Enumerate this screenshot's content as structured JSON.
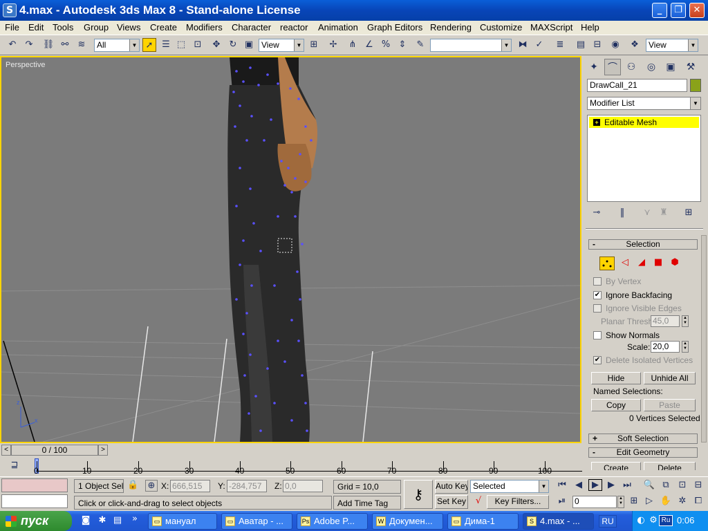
{
  "window": {
    "title": "4.max - Autodesk 3ds Max 8  - Stand-alone License",
    "app_icon": "3ds-max-icon"
  },
  "menu": [
    "File",
    "Edit",
    "Tools",
    "Group",
    "Views",
    "Create",
    "Modifiers",
    "Character",
    "reactor",
    "Animation",
    "Graph Editors",
    "Rendering",
    "Customize",
    "MAXScript",
    "Help"
  ],
  "toolbar": {
    "selection_filter": "All",
    "ref_coord": "View",
    "named_sel": "",
    "view_right": "View"
  },
  "viewport": {
    "label": "Perspective",
    "axis_x": "x",
    "axis_z": "z",
    "border_color": "#ffd400",
    "vertex_color": "#5a50ff"
  },
  "command_panel": {
    "object_name": "DrawCall_21",
    "object_color": "#8aa21a",
    "modifier_list": "Modifier List",
    "stack_item": "Editable Mesh",
    "selection": {
      "title": "Selection",
      "by_vertex": "By Vertex",
      "ignore_backfacing": "Ignore Backfacing",
      "ignore_visible_edges": "Ignore Visible Edges",
      "planar_thresh_label": "Planar Thresh:",
      "planar_thresh_value": "45,0",
      "show_normals": "Show Normals",
      "scale_label": "Scale:",
      "scale_value": "20,0",
      "delete_isolated": "Delete Isolated Vertices",
      "hide": "Hide",
      "unhide_all": "Unhide All",
      "named_selections": "Named Selections:",
      "copy": "Copy",
      "paste": "Paste",
      "vertices_selected": "0 Vertices Selected"
    },
    "soft_selection": "Soft Selection",
    "edit_geometry": "Edit Geometry",
    "create": "Create",
    "delete": "Delete"
  },
  "timeline": {
    "frame": "0 / 100",
    "ticks": [
      "0",
      "10",
      "20",
      "30",
      "40",
      "50",
      "60",
      "70",
      "80",
      "90",
      "100"
    ],
    "prev": "<",
    "next": ">"
  },
  "status": {
    "object_sel": "1 Object Sele",
    "x_label": "X:",
    "x_value": "666,515",
    "y_label": "Y:",
    "y_value": "-284,757",
    "z_label": "Z:",
    "z_value": "0,0",
    "grid": "Grid = 10,0",
    "prompt": "Click or click-and-drag to select objects",
    "add_time_tag": "Add Time Tag",
    "auto_key": "Auto Key",
    "set_key": "Set Key",
    "selected": "Selected",
    "key_filters": "Key Filters...",
    "frame_value": "0"
  },
  "taskbar": {
    "start": "пуск",
    "tasks": [
      "мануал",
      "Аватар - ...",
      "Adobe P...",
      "Докумен...",
      "Дима-1",
      "4.max - ..."
    ],
    "lang": "RU",
    "time": "0:06",
    "tray_lang": "Ru"
  }
}
